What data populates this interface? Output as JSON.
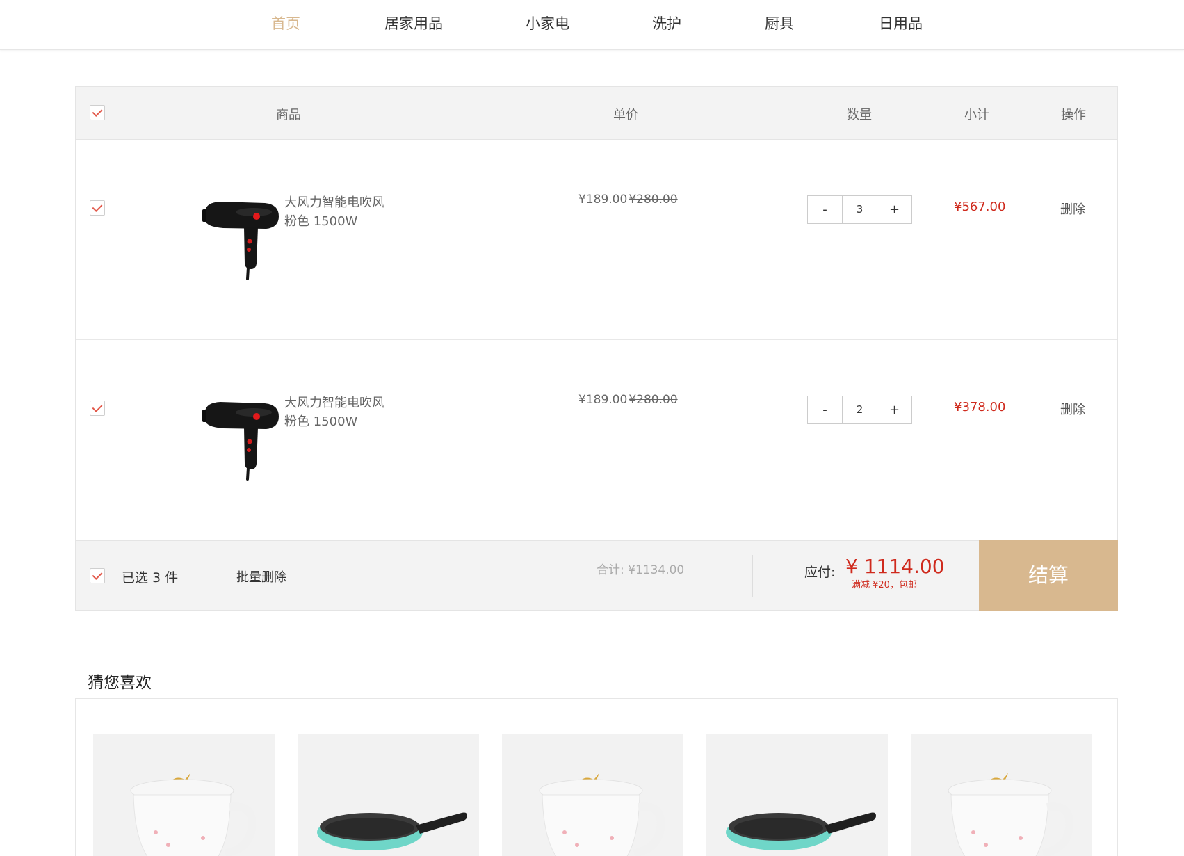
{
  "nav": {
    "items": [
      "首页",
      "居家用品",
      "小家电",
      "洗护",
      "厨具",
      "日用品"
    ],
    "active_index": 0,
    "active_color": "#d8b88f"
  },
  "cart": {
    "headers": {
      "goods": "商品",
      "unit_price": "单价",
      "quantity": "数量",
      "subtotal": "小计",
      "action": "操作"
    },
    "items": [
      {
        "name": "大风力智能电吹风",
        "spec": "粉色 1500W",
        "price": "¥189.00",
        "old_price": "¥280.00",
        "qty": "3",
        "subtotal": "¥567.00",
        "delete": "删除",
        "minus": "-",
        "plus": "+",
        "checked": true,
        "image_icon": "hair-dryer"
      },
      {
        "name": "大风力智能电吹风",
        "spec": "粉色 1500W",
        "price": "¥189.00",
        "old_price": "¥280.00",
        "qty": "2",
        "subtotal": "¥378.00",
        "delete": "删除",
        "minus": "-",
        "plus": "+",
        "checked": true,
        "image_icon": "hair-dryer"
      }
    ],
    "footer": {
      "selected": "已选 3 件",
      "batch_delete": "批量删除",
      "total": "合计: ¥1134.00",
      "pay_label": "应付:",
      "pay_amount": "¥ 1114.00",
      "pay_note": "满减 ¥20，包邮",
      "checkout": "结算"
    },
    "accent_color": "#cf2a1d",
    "checkout_color": "#d8b88f"
  },
  "recommend": {
    "title": "猜您喜欢",
    "items": [
      {
        "image_icon": "mug"
      },
      {
        "image_icon": "frying-pan"
      },
      {
        "image_icon": "mug"
      },
      {
        "image_icon": "frying-pan"
      },
      {
        "image_icon": "mug"
      }
    ]
  }
}
